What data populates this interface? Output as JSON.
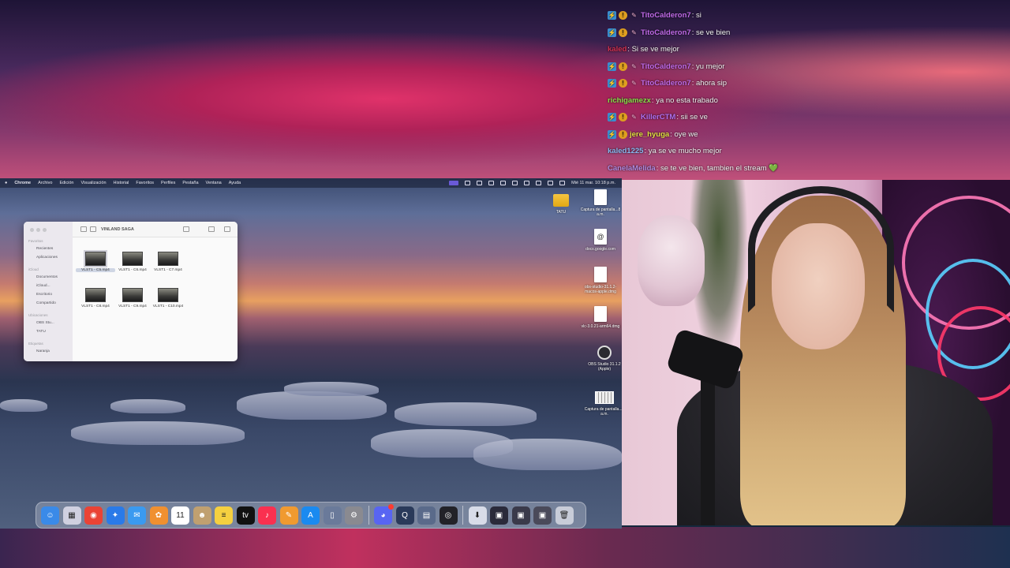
{
  "chat": {
    "messages": [
      {
        "user": "TitoCalderon7",
        "text": ": si",
        "color": "#c06ae8",
        "badges": [
          "blue",
          "gold",
          "rocket"
        ]
      },
      {
        "user": "TitoCalderon7",
        "text": ": se ve bien",
        "color": "#c06ae8",
        "badges": [
          "blue",
          "gold",
          "rocket"
        ]
      },
      {
        "user": "kaled",
        "text": ": Si se ve mejor",
        "color": "#d03050",
        "badges": []
      },
      {
        "user": "TitoCalderon7",
        "text": ": yu mejor",
        "color": "#c06ae8",
        "badges": [
          "blue",
          "gold",
          "rocket"
        ]
      },
      {
        "user": "TitoCalderon7",
        "text": ": ahora sip",
        "color": "#c06ae8",
        "badges": [
          "blue",
          "gold",
          "rocket"
        ]
      },
      {
        "user": "richigamezx",
        "text": ": ya no esta trabado",
        "color": "#8ae04a",
        "badges": []
      },
      {
        "user": "KillerCTM",
        "text": ": sii se ve",
        "color": "#b070f0",
        "badges": [
          "blue",
          "gold",
          "rocket"
        ]
      },
      {
        "user": "jere_hyuga",
        "text": ": oye we",
        "color": "#e0e040",
        "badges": [
          "blue",
          "gold"
        ]
      },
      {
        "user": "kaled1225",
        "text": ": ya se ve mucho mejor",
        "color": "#8ab8f0",
        "badges": []
      },
      {
        "user": "CanelaMelida",
        "text": ": se te ve bien, tambien el stream 💚",
        "color": "#b08ae0",
        "badges": []
      }
    ]
  },
  "menubar": {
    "app": "Chrome",
    "items": [
      "Archivo",
      "Edición",
      "Visualización",
      "Historial",
      "Favoritos",
      "Perfiles",
      "Pestaña",
      "Ventana",
      "Ayuda"
    ],
    "clock": "Mié 11 mar. 10:18 p.m."
  },
  "finder": {
    "title": "VINLAND SAGA",
    "sidebar": {
      "sections": [
        {
          "title": "Favoritos",
          "items": [
            "Recientes",
            "Aplicaciones"
          ]
        },
        {
          "title": "iCloud",
          "items": [
            "Documentos",
            "iCloud...",
            "Escritorio",
            "Compartido"
          ]
        },
        {
          "title": "Ubicaciones",
          "items": [
            "OBS Stu...",
            "TATU"
          ]
        },
        {
          "title": "Etiquetas",
          "items": [
            "Naranja"
          ]
        }
      ]
    },
    "files": [
      "VLST1 - C5.mp4",
      "VLST1 - C6.mp4",
      "VLST1 - C7.mp4",
      "VLST1 - C8.mp4",
      "VLST1 - C9.mp4",
      "VLST1 - C10.mp4"
    ],
    "selected_index": 0
  },
  "desktop": {
    "icons": [
      {
        "label": "TATU",
        "kind": "folder"
      },
      {
        "label": "Captura de pantalla...8 a.m.",
        "kind": "doc"
      },
      {
        "label": "docs.google.com",
        "kind": "link"
      },
      {
        "label": "obs-studio-31.1.2-macos-apple.dmg",
        "kind": "doc"
      },
      {
        "label": "vlc-3.0.21-arm64.dmg",
        "kind": "doc"
      },
      {
        "label": "OBS Studio 31.1.2 (Apple)",
        "kind": "obs"
      },
      {
        "label": "Captura de pantalla...9 a.m.",
        "kind": "shot"
      }
    ]
  },
  "dock": {
    "apps": [
      {
        "name": "finder-icon",
        "glyph": "☺",
        "bg": "#3a8ae8"
      },
      {
        "name": "launchpad-icon",
        "glyph": "▦",
        "bg": "#d0d0e0"
      },
      {
        "name": "chrome-icon",
        "glyph": "◉",
        "bg": "#ea4335"
      },
      {
        "name": "safari-icon",
        "glyph": "✦",
        "bg": "#2a7ae8"
      },
      {
        "name": "mail-icon",
        "glyph": "✉",
        "bg": "#3a9af0"
      },
      {
        "name": "photos-icon",
        "glyph": "✿",
        "bg": "#f09030"
      },
      {
        "name": "calendar-icon",
        "glyph": "11",
        "bg": "#ffffff"
      },
      {
        "name": "contacts-icon",
        "glyph": "☻",
        "bg": "#c0a070"
      },
      {
        "name": "notes-icon",
        "glyph": "≡",
        "bg": "#f5d040"
      },
      {
        "name": "apple-tv-icon",
        "glyph": "tv",
        "bg": "#111111"
      },
      {
        "name": "music-icon",
        "glyph": "♪",
        "bg": "#fa3050"
      },
      {
        "name": "pages-icon",
        "glyph": "✎",
        "bg": "#f09a30"
      },
      {
        "name": "app-store-icon",
        "glyph": "A",
        "bg": "#1a8af0"
      },
      {
        "name": "iphone-mirroring-icon",
        "glyph": "▯",
        "bg": "#6a7a9a"
      },
      {
        "name": "settings-icon",
        "glyph": "⚙",
        "bg": "#8a8a90"
      },
      {
        "name": "discord-icon",
        "glyph": "◕",
        "bg": "#5865f2"
      },
      {
        "name": "quicktime-icon",
        "glyph": "Q",
        "bg": "#2a3a5a"
      },
      {
        "name": "utility-icon",
        "glyph": "▤",
        "bg": "#5a6a8a"
      },
      {
        "name": "obs-icon",
        "glyph": "◎",
        "bg": "#222228"
      },
      {
        "name": "downloads-icon",
        "glyph": "⬇",
        "bg": "#d8dce8"
      },
      {
        "name": "recent-window-1-icon",
        "glyph": "▣",
        "bg": "#2a2a3a"
      },
      {
        "name": "recent-window-2-icon",
        "glyph": "▣",
        "bg": "#3a3a4a"
      },
      {
        "name": "recent-window-3-icon",
        "glyph": "▣",
        "bg": "#4a4a5a"
      },
      {
        "name": "trash-icon",
        "glyph": "🗑",
        "bg": "#c8ccd8"
      }
    ]
  }
}
